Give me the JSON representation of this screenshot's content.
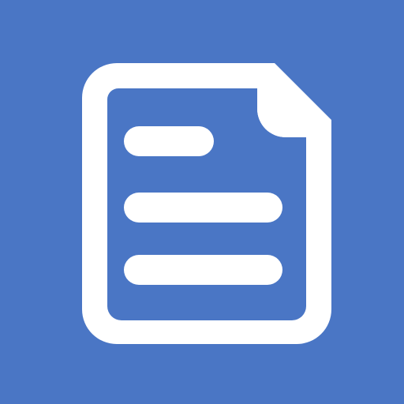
{
  "icon": {
    "name": "document-icon",
    "background_color": "#4a76c5",
    "foreground_color": "#ffffff",
    "text_line_count": 3
  }
}
